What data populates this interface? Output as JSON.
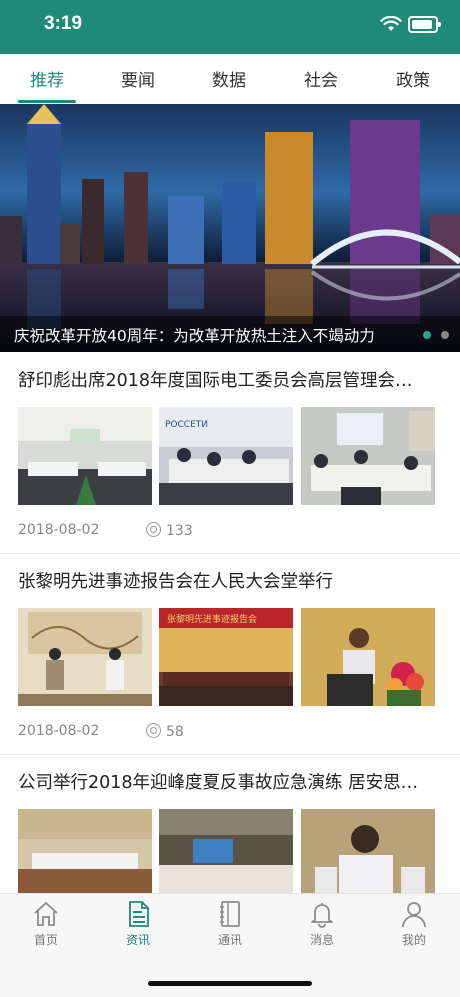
{
  "status_bar": {
    "time": "3:19"
  },
  "tabs": [
    {
      "label": "推荐",
      "active": true
    },
    {
      "label": "要闻"
    },
    {
      "label": "数据"
    },
    {
      "label": "社会"
    },
    {
      "label": "政策"
    }
  ],
  "banner": {
    "caption": "庆祝改革开放40周年：为改革开放热土注入不竭动力",
    "slides": 2,
    "active_slide": 1
  },
  "articles": [
    {
      "title": "舒印彪出席2018年度国际电工委员会高层管理会…",
      "date": "2018-08-02",
      "views": "133",
      "thumb_text": [
        "",
        "РОССЕТИ",
        ""
      ]
    },
    {
      "title": "张黎明先进事迹报告会在人民大会堂举行",
      "date": "2018-08-02",
      "views": "58",
      "thumb_text": [
        "",
        "张黎明先进事迹报告会",
        ""
      ]
    },
    {
      "title": "公司举行2018年迎峰度夏反事故应急演练 居安思…",
      "thumb_text": [
        "",
        "",
        ""
      ]
    }
  ],
  "tabbar": [
    {
      "label": "首页",
      "icon": "home-icon"
    },
    {
      "label": "资讯",
      "icon": "news-icon",
      "active": true
    },
    {
      "label": "通讯",
      "icon": "contacts-icon"
    },
    {
      "label": "消息",
      "icon": "bell-icon"
    },
    {
      "label": "我的",
      "icon": "profile-icon"
    }
  ],
  "colors": {
    "accent": "#1e8a77",
    "text": "#222222",
    "muted": "#888888"
  }
}
